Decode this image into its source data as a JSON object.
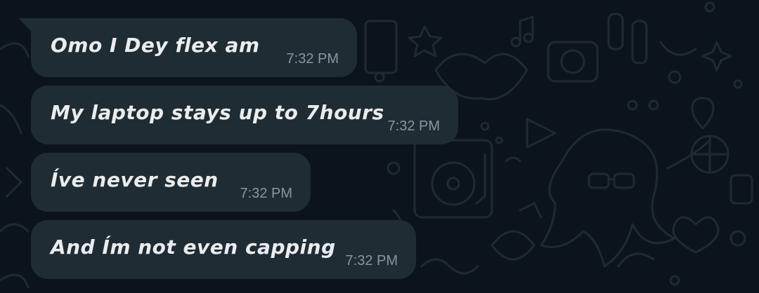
{
  "messages": [
    {
      "text": "Omo I Dey flex am",
      "time": "7:32 PM"
    },
    {
      "text": "My laptop stays up to 7hours",
      "time": "7:32 PM"
    },
    {
      "text": "Íve never seen",
      "time": "7:32 PM"
    },
    {
      "text": "And Ím not even capping",
      "time": "7:32 PM"
    }
  ],
  "colors": {
    "background": "#0b141a",
    "bubble": "#202c33",
    "text": "#e9edef",
    "timestamp": "#8696a0",
    "doodle": "#1f2a30"
  }
}
